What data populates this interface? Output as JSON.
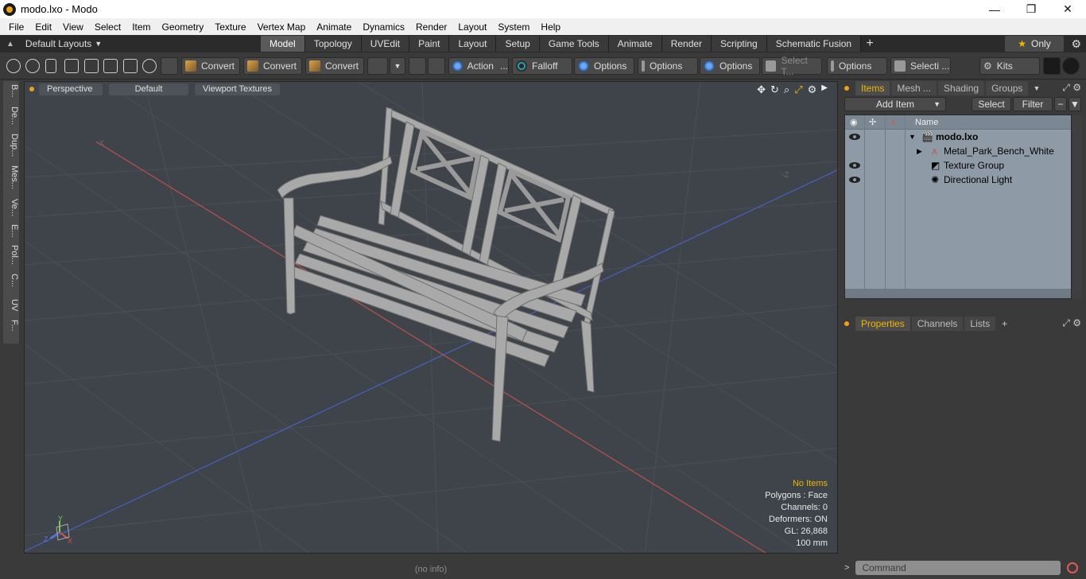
{
  "window": {
    "title": "modo.lxo - Modo"
  },
  "menu": [
    "File",
    "Edit",
    "View",
    "Select",
    "Item",
    "Geometry",
    "Texture",
    "Vertex Map",
    "Animate",
    "Dynamics",
    "Render",
    "Layout",
    "System",
    "Help"
  ],
  "layouts": {
    "label": "Default Layouts"
  },
  "tabs": [
    "Model",
    "Topology",
    "UVEdit",
    "Paint",
    "Layout",
    "Setup",
    "Game Tools",
    "Animate",
    "Render",
    "Scripting",
    "Schematic Fusion"
  ],
  "only_label": "Only",
  "toolbar": {
    "convert1": "Convert",
    "convert2": "Convert",
    "convert3": "Convert",
    "action": "Action",
    "falloff": "Falloff",
    "options1": "Options",
    "options2": "Options",
    "options3": "Options",
    "options4": "Options",
    "select_t": "Select T...",
    "selecti": "Selecti ...",
    "kits": "Kits"
  },
  "left_tabs": [
    "B...",
    "De...",
    "Dup...",
    "Mes...",
    "Ve...",
    "E...",
    "Pol...",
    "C...",
    "UV",
    "F..."
  ],
  "viewport": {
    "perspective": "Perspective",
    "default": "Default",
    "textures": "Viewport Textures",
    "stats": {
      "no_items": "No Items",
      "polygons": "Polygons : Face",
      "channels": "Channels: 0",
      "deformers": "Deformers: ON",
      "gl": "GL: 26,868",
      "scale": "100 mm"
    }
  },
  "status": "(no info)",
  "items_panel": {
    "tabs": [
      "Items",
      "Mesh ...",
      "Shading",
      "Groups"
    ],
    "add_item": "Add Item",
    "select": "Select",
    "filter": "Filter",
    "name_header": "Name",
    "tree": [
      "modo.lxo",
      "Metal_Park_Bench_White",
      "Texture Group",
      "Directional Light"
    ]
  },
  "props_panel": {
    "tabs": [
      "Properties",
      "Channels",
      "Lists"
    ]
  },
  "command": {
    "placeholder": "Command"
  },
  "colors": {
    "accent": "#f2b600",
    "x_axis": "#c0504d",
    "z_axis": "#4a5fc0",
    "viewport_bg": "#3e4449"
  }
}
